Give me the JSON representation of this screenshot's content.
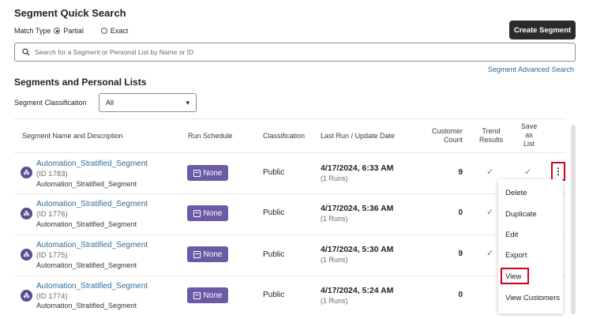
{
  "quick_search": {
    "title": "Segment Quick Search",
    "match_type_label": "Match Type",
    "options": [
      "Partial",
      "Exact"
    ],
    "selected": "Partial",
    "search_placeholder": "Search for a Segment or Personal List by Name or ID",
    "create_button": "Create Segment",
    "advanced_link": "Segment Advanced Search"
  },
  "segments": {
    "title": "Segments and Personal Lists",
    "classification_label": "Segment Classification",
    "classification_value": "All",
    "columns": {
      "name": "Segment Name and Description",
      "run_schedule": "Run Schedule",
      "classification": "Classification",
      "last_run": "Last Run / Update Date",
      "count_l1": "Customer",
      "count_l2": "Count",
      "trend_l1": "Trend",
      "trend_l2": "Results",
      "save_l1": "Save",
      "save_l2": "as",
      "save_l3": "List"
    },
    "rows": [
      {
        "name": "Automation_Stratified_Segment",
        "id": "(ID 1783)",
        "desc": "Automation_Stratified_Segment",
        "schedule": "None",
        "classification": "Public",
        "date": "4/17/2024, 6:33 AM",
        "runs": "(1 Runs)",
        "count": "9"
      },
      {
        "name": "Automation_Stratified_Segment",
        "id": "(ID 1776)",
        "desc": "Automation_Stratified_Segment",
        "schedule": "None",
        "classification": "Public",
        "date": "4/17/2024, 5:36 AM",
        "runs": "(1 Runs)",
        "count": "0"
      },
      {
        "name": "Automation_Stratified_Segment",
        "id": "(ID 1775)",
        "desc": "Automation_Stratified_Segment",
        "schedule": "None",
        "classification": "Public",
        "date": "4/17/2024, 5:30 AM",
        "runs": "(1 Runs)",
        "count": "9"
      },
      {
        "name": "Automation_Stratified_Segment",
        "id": "(ID 1774)",
        "desc": "Automation_Stratified_Segment",
        "schedule": "None",
        "classification": "Public",
        "date": "4/17/2024, 5:24 AM",
        "runs": "(1 Runs)",
        "count": "0"
      }
    ]
  },
  "action_menu": {
    "items": [
      "Delete",
      "Duplicate",
      "Edit",
      "Export",
      "View",
      "View Customers"
    ],
    "highlighted": "View"
  },
  "icons": {
    "check": "✓",
    "kebab": "⋮",
    "caret": "▾",
    "search": "search-icon",
    "segment": "segment-icon",
    "calendar": "calendar-icon"
  },
  "colors": {
    "accent_purple": "#6b5aa6",
    "link_blue": "#2f6b9a",
    "highlight_red": "#d0021b",
    "dark_button": "#2b2b2b"
  }
}
